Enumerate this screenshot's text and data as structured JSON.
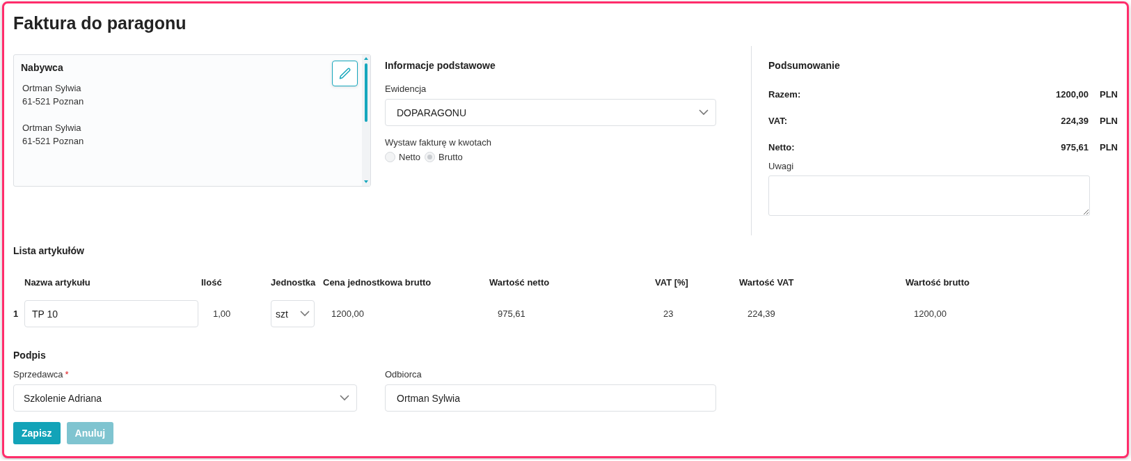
{
  "title": "Faktura do paragonu",
  "buyer": {
    "heading": "Nabywca",
    "addresses": [
      {
        "lines": [
          "Ortman Sylwia",
          "61-521 Poznan"
        ]
      },
      {
        "lines": [
          "Ortman Sylwia",
          "61-521 Poznan"
        ]
      }
    ]
  },
  "basic_info": {
    "heading": "Informacje podstawowe",
    "ewidencja": {
      "label": "Ewidencja",
      "value": "DOPARAGONU"
    },
    "amounts": {
      "label": "Wystaw fakturę w kwotach",
      "options": [
        {
          "label": "Netto",
          "selected": false
        },
        {
          "label": "Brutto",
          "selected": true
        }
      ]
    }
  },
  "summary": {
    "heading": "Podsumowanie",
    "rows": [
      {
        "label": "Razem:",
        "value": "1200,00",
        "currency": "PLN"
      },
      {
        "label": "VAT:",
        "value": "224,39",
        "currency": "PLN"
      },
      {
        "label": "Netto:",
        "value": "975,61",
        "currency": "PLN"
      }
    ],
    "notes": {
      "label": "Uwagi"
    }
  },
  "items": {
    "heading": "Lista artykułów",
    "columns": [
      "Nazwa artykułu",
      "Ilość",
      "Jednostka",
      "Cena jednostkowa brutto",
      "Wartość netto",
      "VAT [%]",
      "Wartość VAT",
      "Wartość brutto"
    ],
    "rows": [
      {
        "index": "1",
        "name": "TP 10",
        "quantity": "1,00",
        "unit": "szt",
        "unit_price": "1200,00",
        "net": "975,61",
        "vat_rate": "23",
        "vat": "224,39",
        "gross": "1200,00"
      }
    ]
  },
  "signature": {
    "heading": "Podpis",
    "seller": {
      "label": "Sprzedawca",
      "required_mark": "*",
      "value": "Szkolenie Adriana"
    },
    "receiver": {
      "label": "Odbiorca",
      "value": "Ortman Sylwia"
    }
  },
  "buttons": [
    {
      "label": "Zapisz",
      "disabled": false
    },
    {
      "label": "Anuluj",
      "disabled": true
    }
  ]
}
